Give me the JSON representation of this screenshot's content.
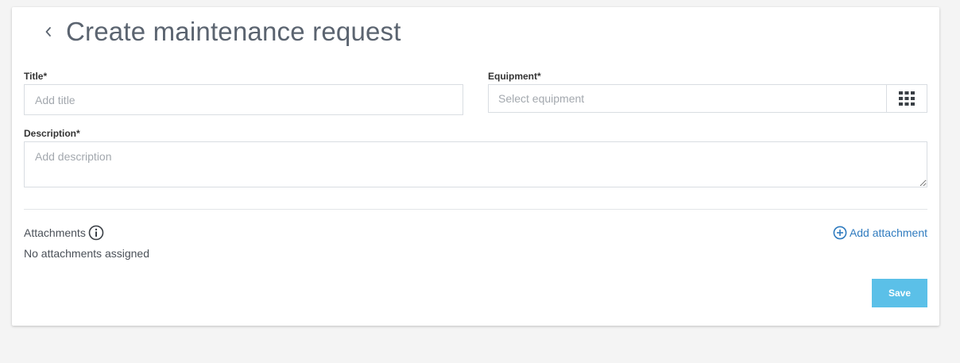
{
  "header": {
    "title": "Create maintenance request",
    "back_icon": "chevron-left-icon"
  },
  "form": {
    "title_label": "Title*",
    "title_placeholder": "Add title",
    "title_value": "",
    "equipment_label": "Equipment*",
    "equipment_placeholder": "Select equipment",
    "equipment_value": "",
    "equipment_picker_icon": "grid-icon",
    "description_label": "Description*",
    "description_placeholder": "Add description",
    "description_value": ""
  },
  "attachments": {
    "label": "Attachments",
    "info_icon": "info-icon",
    "empty_text": "No attachments assigned",
    "add_label": "Add attachment",
    "add_icon": "plus-circle-icon"
  },
  "actions": {
    "save_label": "Save"
  },
  "colors": {
    "background": "#f4f4f4",
    "card": "#ffffff",
    "title_text": "#5b6470",
    "link": "#2f7bbf",
    "save_button": "#5bc0e8",
    "border": "#d9dde2"
  }
}
